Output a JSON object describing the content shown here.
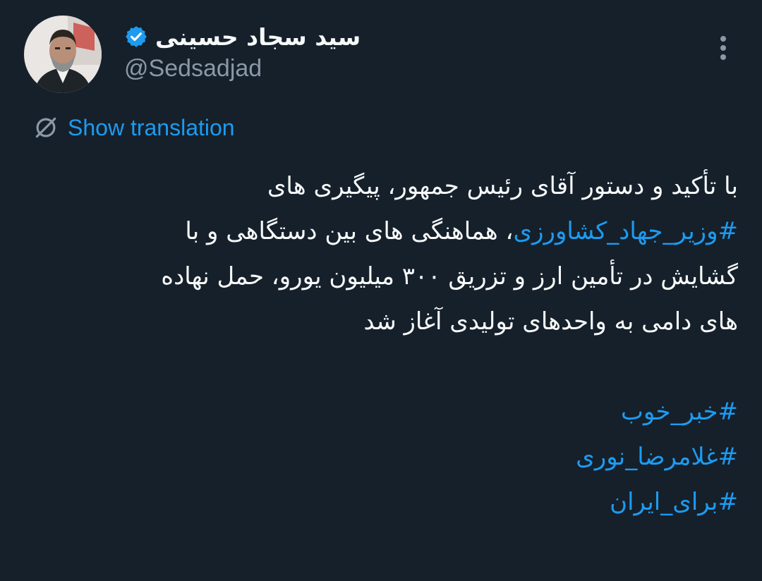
{
  "author": {
    "display_name": "سید سجاد حسینی",
    "handle": "@Sedsadjad",
    "verified": true,
    "verified_badge_color": "#1d9bf0",
    "avatar_icon": "profile-photo"
  },
  "menu": {
    "icon": "more-vertical-icon"
  },
  "translation": {
    "label": "Show translation",
    "icon": "globe-slash-icon",
    "color": "#1d9bf0"
  },
  "tweet": {
    "lines": [
      {
        "text": "با تأکید و دستور آقای رئیس جمهور، پیگیری های"
      },
      {
        "hashtag": "#وزیر_جهاد_کشاورزی",
        "text": "، هماهنگی های بین دستگاهی و با"
      },
      {
        "text": "گشایش در تأمین ارز و تزریق ۳۰۰ میلیون یورو، حمل نهاده"
      },
      {
        "text": "های دامی به واحدهای تولیدی آغاز شد"
      }
    ],
    "hashtags": [
      "#خبر_خوب",
      "#غلامرضا_نوری",
      "#برای_ایران"
    ]
  },
  "colors": {
    "background": "#15202b",
    "text": "#f7f9f9",
    "secondary_text": "#8b98a5",
    "link": "#1d9bf0"
  }
}
